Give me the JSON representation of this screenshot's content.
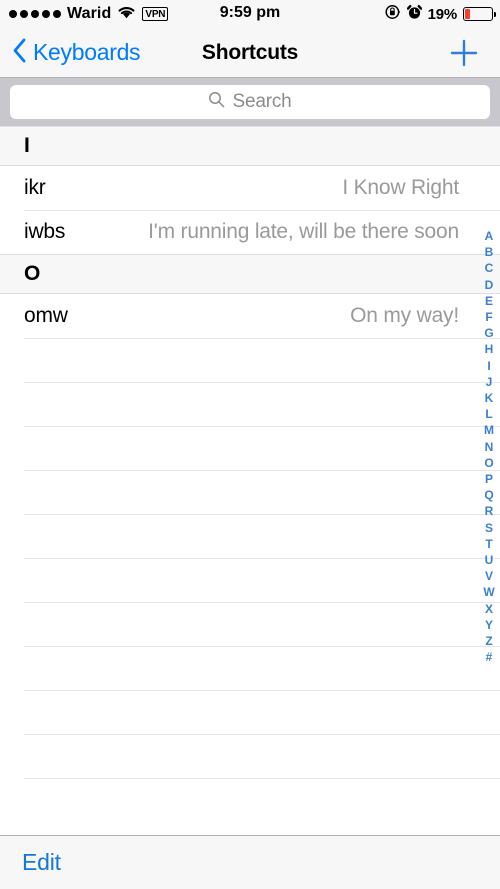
{
  "status_bar": {
    "carrier": "Warid",
    "signal_dots_filled": 5,
    "signal_dots_total": 5,
    "wifi_icon": "wifi-icon",
    "vpn_label": "VPN",
    "time": "9:59 pm",
    "rotation_lock_icon": "rotation-lock-icon",
    "alarm_icon": "alarm-clock-icon",
    "battery_percent_label": "19%",
    "battery_level": 19,
    "battery_color": "#fd3b2f"
  },
  "nav_bar": {
    "back_icon": "chevron-left-icon",
    "back_label": "Keyboards",
    "title": "Shortcuts",
    "add_icon": "plus-icon",
    "tint_color": "#007aff"
  },
  "search": {
    "icon": "search-icon",
    "placeholder": "Search",
    "value": ""
  },
  "list": {
    "sections": [
      {
        "header": "I",
        "rows": [
          {
            "shortcut": "ikr",
            "phrase": "I Know Right"
          },
          {
            "shortcut": "iwbs",
            "phrase": "I'm running late, will be there soon"
          }
        ]
      },
      {
        "header": "O",
        "rows": [
          {
            "shortcut": "omw",
            "phrase": "On my way!"
          }
        ]
      }
    ],
    "empty_row_count": 11
  },
  "index_bar": {
    "letters": [
      "A",
      "B",
      "C",
      "D",
      "E",
      "F",
      "G",
      "H",
      "I",
      "J",
      "K",
      "L",
      "M",
      "N",
      "O",
      "P",
      "Q",
      "R",
      "S",
      "T",
      "U",
      "V",
      "W",
      "X",
      "Y",
      "Z",
      "#"
    ],
    "color": "#3c7fd0"
  },
  "toolbar": {
    "edit_label": "Edit",
    "tint_color": "#1578d4"
  }
}
